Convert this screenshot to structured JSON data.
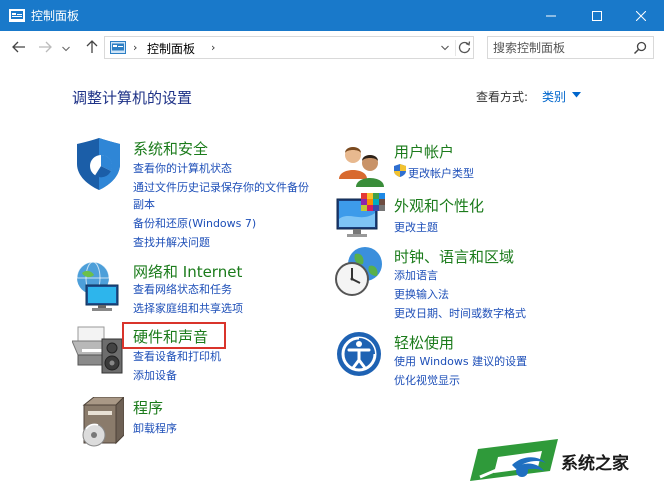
{
  "window": {
    "title": "控制面板"
  },
  "navbar": {
    "breadcrumb": "控制面板",
    "search_placeholder": "搜索控制面板"
  },
  "main": {
    "heading": "调整计算机的设置",
    "view_by_label": "查看方式:",
    "view_by_value": "类别"
  },
  "categories": [
    {
      "title": "系统和安全",
      "icon": "shield-icon",
      "links": [
        "查看你的计算机状态",
        "通过文件历史记录保存你的文件备份副本",
        "备份和还原(Windows 7)",
        "查找并解决问题"
      ]
    },
    {
      "title": "网络和 Internet",
      "icon": "network-icon",
      "links": [
        "查看网络状态和任务",
        "选择家庭组和共享选项"
      ]
    },
    {
      "title": "硬件和声音",
      "icon": "printer-icon",
      "links": [
        "查看设备和打印机",
        "添加设备"
      ]
    },
    {
      "title": "程序",
      "icon": "programs-icon",
      "links": [
        "卸载程序"
      ]
    },
    {
      "title": "用户帐户",
      "icon": "users-icon",
      "links": [
        "更改帐户类型"
      ]
    },
    {
      "title": "外观和个性化",
      "icon": "appearance-icon",
      "links": [
        "更改主题"
      ]
    },
    {
      "title": "时钟、语言和区域",
      "icon": "clock-globe-icon",
      "links": [
        "添加语言",
        "更换输入法",
        "更改日期、时间或数字格式"
      ]
    },
    {
      "title": "轻松使用",
      "icon": "ease-of-access-icon",
      "links": [
        "使用 Windows 建议的设置",
        "优化视觉显示"
      ]
    }
  ],
  "link_line_2a": "通过文件历史记录保存你的文件备份",
  "link_line_2b": "副本",
  "watermark": {
    "text": "系统之家"
  },
  "colors": {
    "titlebar": "#1979ca",
    "category_title": "#1b7b1b",
    "link": "#1e4fb8",
    "heading": "#1e3287",
    "highlight_box": "#d9342b"
  }
}
